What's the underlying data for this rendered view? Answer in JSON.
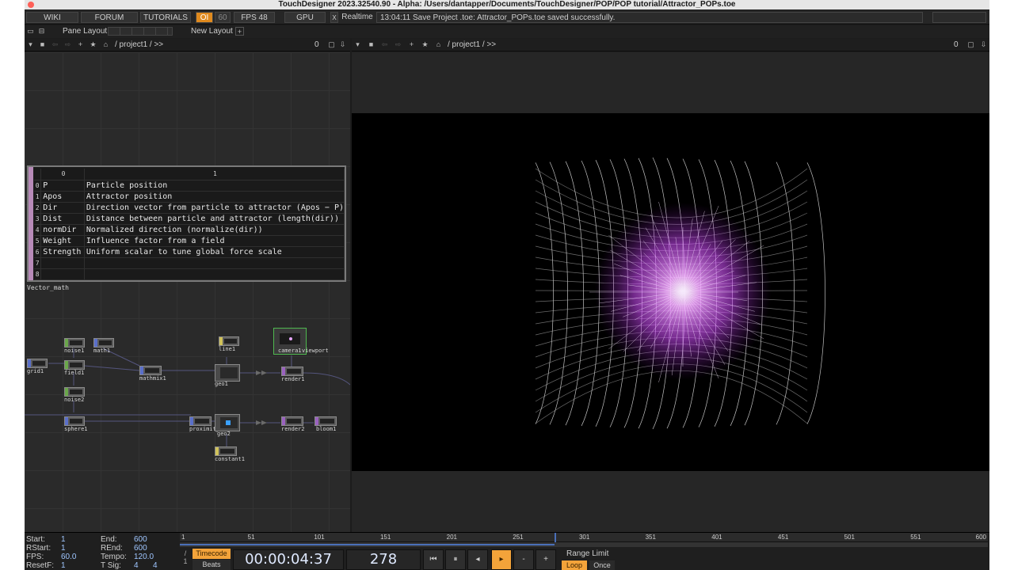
{
  "title": "TouchDesigner 2023.32540.90 - Alpha: /Users/dantapper/Documents/TouchDesigner/POP/POP tutorial/Attractor_POPs.toe",
  "menu": {
    "wiki": "WIKI",
    "forum": "FORUM",
    "tutorials": "TUTORIALS",
    "oi": "OI",
    "sixty": "60",
    "fps_label": "FPS 48",
    "gpu": "GPU",
    "realtime_check": "X",
    "realtime": "Realtime",
    "status": "13:04:11 Save Project .toe: Attractor_POPs.toe saved successfully."
  },
  "toolbar": {
    "pane_layout": "Pane Layout",
    "new_layout": "New Layout",
    "plus": "+"
  },
  "left_path": {
    "path": "/ project1 / >>",
    "count": "0"
  },
  "right_path": {
    "path": "/ project1 / >>",
    "count": "0"
  },
  "table": {
    "header": [
      "0",
      "1"
    ],
    "rows": [
      {
        "i": "0",
        "name": "P",
        "desc": "Particle position"
      },
      {
        "i": "1",
        "name": "Apos",
        "desc": "Attractor position"
      },
      {
        "i": "2",
        "name": "Dir",
        "desc": "Direction vector from particle to attractor (Apos − P)"
      },
      {
        "i": "3",
        "name": "Dist",
        "desc": "Distance between particle and attractor (length(dir))"
      },
      {
        "i": "4",
        "name": "normDir",
        "desc": "Normalized direction (normalize(dir))"
      },
      {
        "i": "5",
        "name": "Weight",
        "desc": "Influence factor from a field"
      },
      {
        "i": "6",
        "name": "Strength",
        "desc": "Uniform scalar to tune global force scale"
      },
      {
        "i": "7",
        "name": "",
        "desc": ""
      },
      {
        "i": "8",
        "name": "",
        "desc": ""
      }
    ],
    "name": "Vector_math"
  },
  "nodes": {
    "grid1": "grid1",
    "noise1": "noise1",
    "math1": "math1",
    "field1": "field1",
    "noise2": "noise2",
    "sphere1": "sphere1",
    "mathmix1": "mathmix1",
    "line1": "line1",
    "geo1": "geo1",
    "camera1": "camera1",
    "viewport": "viewport",
    "render1": "render1",
    "proximity1": "proximity1",
    "geo2": "geo2",
    "render2": "render2",
    "bloom1": "bloom1",
    "constant1": "constant1"
  },
  "timeline": {
    "start_label": "Start:",
    "start": "1",
    "rstart_label": "RStart:",
    "rstart": "1",
    "fps_label": "FPS:",
    "fps": "60.0",
    "resetf_label": "ResetF:",
    "resetf": "1",
    "end_label": "End:",
    "end": "600",
    "rend_label": "REnd:",
    "rend": "600",
    "tempo_label": "Tempo:",
    "tempo": "120.0",
    "tsig_label": "T Sig:",
    "tsig_a": "4",
    "tsig_b": "4",
    "ticks": [
      "1",
      "51",
      "101",
      "151",
      "201",
      "251",
      "301",
      "351",
      "401",
      "451",
      "501",
      "551",
      "600"
    ],
    "timecode_btn": "Timecode",
    "beats_btn": "Beats",
    "timecode": "00:00:04:37",
    "frame": "278",
    "frame_value": 278,
    "frame_end": 600,
    "range_limit": "Range Limit",
    "loop": "Loop",
    "once": "Once",
    "minus": "-",
    "plus": "+"
  },
  "colors": {
    "accent_orange": "#f3a33a",
    "timecode_blue": "#9fc6ff",
    "table_strip": "#b78ab8",
    "glow": "#d24cff"
  }
}
